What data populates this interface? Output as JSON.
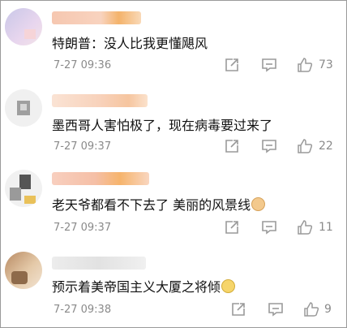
{
  "comments": [
    {
      "text": "特朗普：没人比我更懂飓风",
      "time": "7-27 09:36",
      "likes": "73",
      "emoji": ""
    },
    {
      "text": "墨西哥人害怕极了，现在病毒要过来了",
      "time": "7-27 09:37",
      "likes": "22",
      "emoji": ""
    },
    {
      "text": "老天爷都看不下去了 美丽的风景线",
      "time": "7-27 09:37",
      "likes": "11",
      "emoji": "cat-emoji"
    },
    {
      "text": "预示着美帝国主义大厦之将倾",
      "time": "7-27 09:38",
      "likes": "9",
      "emoji": "crying-emoji"
    }
  ],
  "icons": {
    "share": "share-icon",
    "comment": "comment-icon",
    "like": "thumbs-up-icon"
  },
  "colors": {
    "text": "#111111",
    "meta": "#8a8a8a",
    "icon": "#9a9a9a"
  }
}
